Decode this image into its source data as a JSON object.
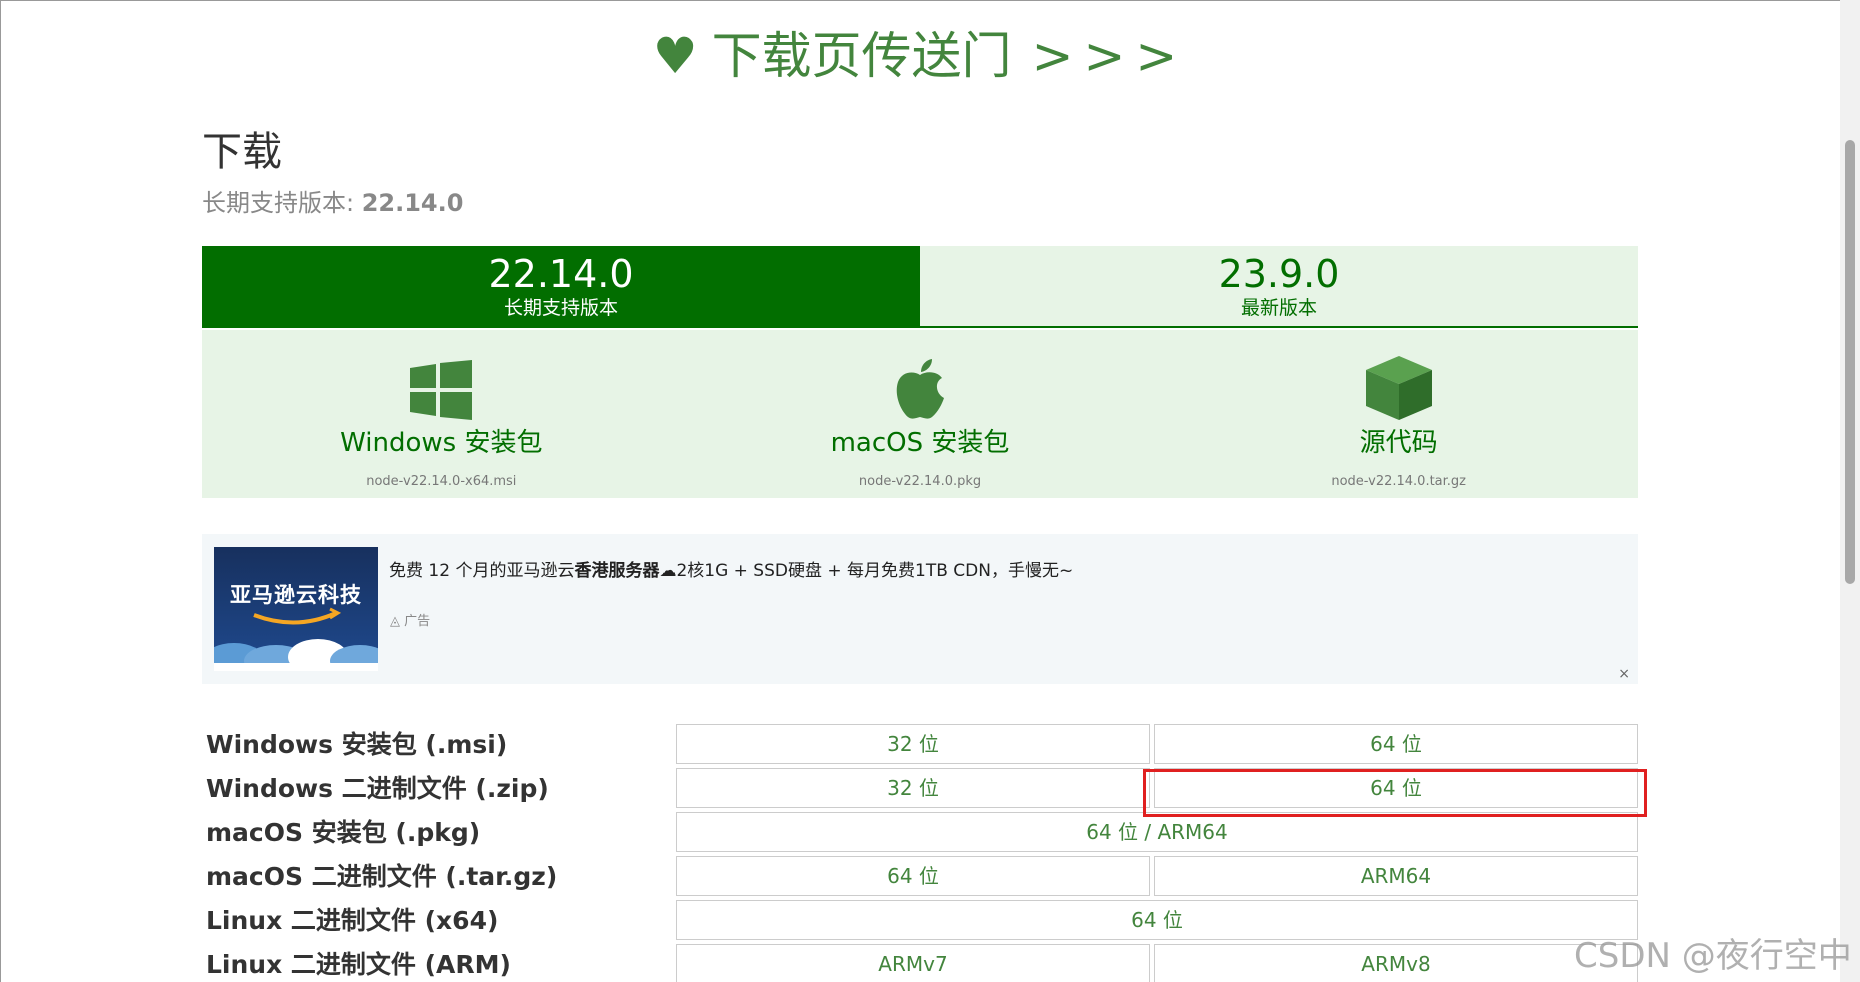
{
  "banner": {
    "heart": "♥",
    "text": "下载页传送门",
    "arrows": ">>>"
  },
  "page": {
    "title": "下载",
    "subtitle_prefix": "长期支持版本: ",
    "subtitle_version": "22.14.0"
  },
  "version_tabs": [
    {
      "version": "22.14.0",
      "label": "长期支持版本",
      "active": true
    },
    {
      "version": "23.9.0",
      "label": "最新版本",
      "active": false
    }
  ],
  "cards": [
    {
      "title": "Windows 安装包",
      "file": "node-v22.14.0-x64.msi",
      "icon": "windows-icon"
    },
    {
      "title": "macOS 安装包",
      "file": "node-v22.14.0.pkg",
      "icon": "apple-icon"
    },
    {
      "title": "源代码",
      "file": "node-v22.14.0.tar.gz",
      "icon": "box-icon"
    }
  ],
  "ad": {
    "thumb_text": "亚马逊云科技",
    "text_before": "免费 12 个月的亚马逊云",
    "text_bold": "香港服务器",
    "text_after": "☁2核1G + SSD硬盘 + 每月免费1TB CDN，手慢无~",
    "label": "广告",
    "close": "×"
  },
  "downloads": [
    {
      "label": "Windows 安装包 (.msi)",
      "options": [
        "32 位",
        "64 位"
      ]
    },
    {
      "label": "Windows 二进制文件 (.zip)",
      "options": [
        "32 位",
        "64 位"
      ]
    },
    {
      "label": "macOS 安装包 (.pkg)",
      "options": [
        "64 位 / ARM64"
      ]
    },
    {
      "label": "macOS 二进制文件 (.tar.gz)",
      "options": [
        "64 位",
        "ARM64"
      ]
    },
    {
      "label": "Linux 二进制文件 (x64)",
      "options": [
        "64 位"
      ]
    },
    {
      "label": "Linux 二进制文件 (ARM)",
      "options": [
        "ARMv7",
        "ARMv8"
      ]
    }
  ],
  "watermark": "CSDN @夜行空中",
  "colors": {
    "green": "#026e00",
    "light_green": "#e7f4e6",
    "link_green": "#43853d",
    "highlight": "#e02020"
  }
}
